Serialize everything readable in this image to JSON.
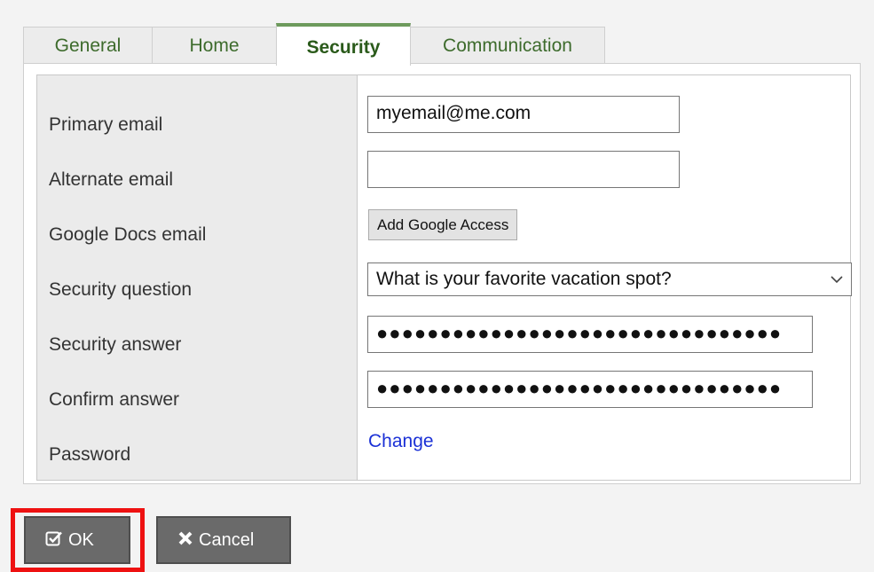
{
  "tabs": [
    {
      "label": "General"
    },
    {
      "label": "Home"
    },
    {
      "label": "Security"
    },
    {
      "label": "Communication"
    }
  ],
  "form": {
    "primary_email": {
      "label": "Primary email",
      "value": "myemail@me.com"
    },
    "alternate_email": {
      "label": "Alternate email",
      "value": ""
    },
    "google_docs_email": {
      "label": "Google Docs email",
      "button": "Add Google Access"
    },
    "security_question": {
      "label": "Security question",
      "selected": "What is your favorite vacation spot?"
    },
    "security_answer": {
      "label": "Security answer",
      "value": "●●●●●●●●●●●●●●●●●●●●●●●●●●●●●●●●"
    },
    "confirm_answer": {
      "label": "Confirm answer",
      "value": "●●●●●●●●●●●●●●●●●●●●●●●●●●●●●●●●"
    },
    "password": {
      "label": "Password",
      "link": "Change"
    }
  },
  "footer": {
    "ok_label": "OK",
    "cancel_label": "Cancel"
  },
  "icons": {
    "ok": "checkbox-icon",
    "cancel": "x-icon",
    "select": "chevron-down-icon"
  },
  "colors": {
    "tab_text": "#3d6b2c",
    "tab_active_border": "#6d9a5c",
    "link": "#1b31d6",
    "highlight": "#ee1111",
    "button_bg": "#6a6a6a"
  }
}
